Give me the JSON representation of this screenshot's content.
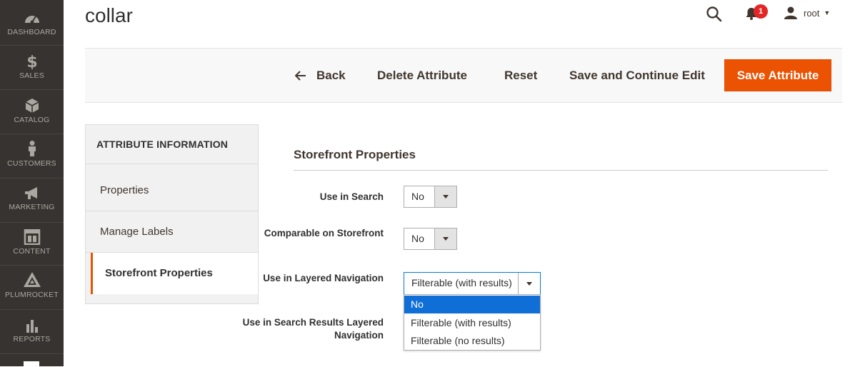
{
  "nav": {
    "items": [
      {
        "label": "DASHBOARD",
        "icon": "dashboard-icon"
      },
      {
        "label": "SALES",
        "icon": "dollar-icon"
      },
      {
        "label": "CATALOG",
        "icon": "cube-icon"
      },
      {
        "label": "CUSTOMERS",
        "icon": "person-icon"
      },
      {
        "label": "MARKETING",
        "icon": "megaphone-icon"
      },
      {
        "label": "CONTENT",
        "icon": "layout-icon"
      },
      {
        "label": "PLUMROCKET",
        "icon": "rocket-icon"
      },
      {
        "label": "REPORTS",
        "icon": "bar-chart-icon"
      }
    ]
  },
  "header": {
    "title": "collar",
    "notifications_count": "1",
    "user": "root"
  },
  "toolbar": {
    "back_label": "Back",
    "delete_label": "Delete Attribute",
    "reset_label": "Reset",
    "save_continue_label": "Save and Continue Edit",
    "save_label": "Save Attribute"
  },
  "tabs": {
    "heading": "ATTRIBUTE INFORMATION",
    "items": [
      {
        "label": "Properties"
      },
      {
        "label": "Manage Labels"
      },
      {
        "label": "Storefront Properties"
      }
    ]
  },
  "section": {
    "title": "Storefront Properties",
    "fields": [
      {
        "label": "Use in Search",
        "value": "No"
      },
      {
        "label": "Comparable on Storefront",
        "value": "No"
      },
      {
        "label": "Use in Layered Navigation",
        "value": "Filterable (with results)"
      },
      {
        "label": "Use in Search Results Layered Navigation"
      }
    ],
    "dropdown_options": [
      "No",
      "Filterable (with results)",
      "Filterable (no results)"
    ]
  },
  "colors": {
    "nav_bg": "#373330",
    "accent": "#eb5202",
    "highlight": "#0f6fd7",
    "badge": "#e22626"
  }
}
